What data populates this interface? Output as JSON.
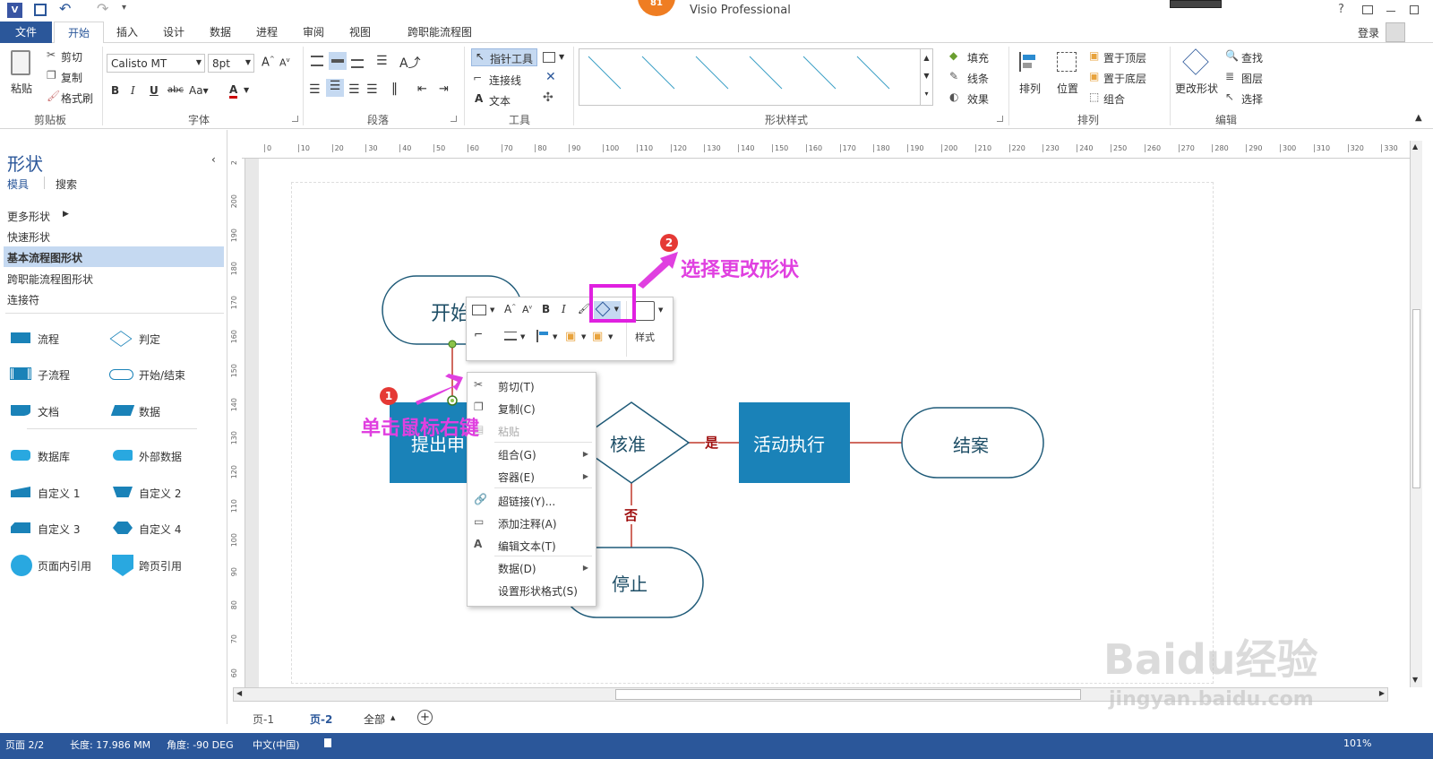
{
  "titlebar": {
    "title": "Visio Professional",
    "badge": "81"
  },
  "tabs": [
    "文件",
    "开始",
    "插入",
    "设计",
    "数据",
    "进程",
    "审阅",
    "视图",
    "跨职能流程图"
  ],
  "account": {
    "login": "登录"
  },
  "ribbon": {
    "clipboard": {
      "paste": "粘贴",
      "cut": "剪切",
      "copy": "复制",
      "format_painter": "格式刷",
      "label": "剪贴板"
    },
    "font": {
      "family": "Calisto MT",
      "size": "8pt",
      "label": "字体"
    },
    "paragraph": {
      "label": "段落"
    },
    "tools": {
      "pointer": "指针工具",
      "connector": "连接线",
      "text": "文本",
      "label": "工具"
    },
    "shape_styles": {
      "label": "形状样式",
      "fill": "填充",
      "line": "线条",
      "effect": "效果"
    },
    "arrange": {
      "align": "排列",
      "position": "位置",
      "bring_front": "置于顶层",
      "send_back": "置于底层",
      "group": "组合",
      "label": "排列"
    },
    "editing": {
      "change_shape": "更改形状",
      "find": "查找",
      "layers": "图层",
      "select": "选择",
      "label": "编辑"
    }
  },
  "sidebar": {
    "title": "形状",
    "tab_stencils": "模具",
    "tab_search": "搜索",
    "items": [
      "更多形状",
      "快速形状",
      "基本流程图形状",
      "跨职能流程图形状",
      "连接符"
    ],
    "stencils": [
      "流程",
      "判定",
      "子流程",
      "开始/结束",
      "文档",
      "数据",
      "数据库",
      "外部数据",
      "自定义 1",
      "自定义 2",
      "自定义 3",
      "自定义 4",
      "页面内引用",
      "跨页引用"
    ]
  },
  "ruler_top": [
    "0",
    "10",
    "20",
    "30",
    "40",
    "50",
    "60",
    "70",
    "80",
    "90",
    "100",
    "110",
    "120",
    "130",
    "140",
    "150",
    "160",
    "170",
    "180",
    "190",
    "200",
    "210",
    "220",
    "230",
    "240",
    "250",
    "260",
    "270",
    "280",
    "290",
    "300",
    "310",
    "320",
    "330"
  ],
  "ruler_left": [
    "2",
    "200",
    "190",
    "180",
    "170",
    "160",
    "150",
    "140",
    "130",
    "120",
    "110",
    "100",
    "90",
    "80",
    "70",
    "60"
  ],
  "flowchart": {
    "start": "开始",
    "submit": "提出申",
    "approve": "核准",
    "execute": "活动执行",
    "close": "结案",
    "stop": "停止",
    "yes": "是",
    "no": "否"
  },
  "mini_toolbar": {
    "style": "样式"
  },
  "context_menu": {
    "cut": "剪切(T)",
    "copy": "复制(C)",
    "paste": "粘贴",
    "group": "组合(G)",
    "container": "容器(E)",
    "hyperlink": "超链接(Y)...",
    "comment": "添加注释(A)",
    "edit_text": "编辑文本(T)",
    "data": "数据(D)",
    "format_shape": "设置形状格式(S)"
  },
  "annotations": {
    "step1_num": "1",
    "step1_text": "单击鼠标右键",
    "step2_num": "2",
    "step2_text": "选择更改形状"
  },
  "pagebar": {
    "page1": "页-1",
    "page2": "页-2",
    "all": "全部"
  },
  "statusbar": {
    "page": "页面 2/2",
    "length": "长度: 17.986 MM",
    "angle": "角度: -90 DEG",
    "lang": "中文(中国)",
    "zoom": "101%"
  },
  "watermark": {
    "brand": "Baidu经验",
    "url": "jingyan.baidu.com"
  },
  "colors": {
    "accent": "#2b579a",
    "process": "#1a82b8",
    "outline": "#1e5a78",
    "connector": "#c0392b",
    "annotation": "#e040e0"
  }
}
